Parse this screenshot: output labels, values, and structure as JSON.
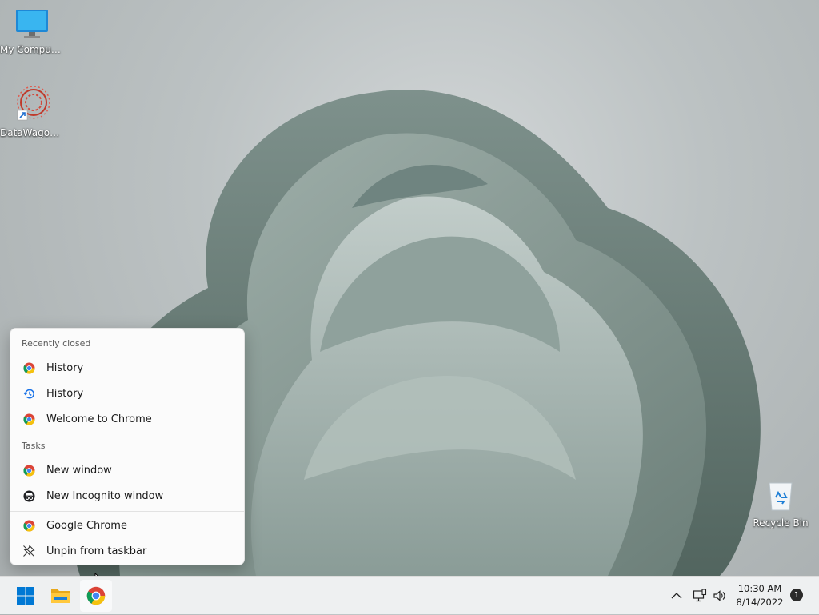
{
  "desktop": {
    "icons": [
      {
        "label": "My Computer",
        "icon": "monitor-icon"
      },
      {
        "label": "DataWagon...",
        "icon": "datawagon-app-icon"
      },
      {
        "label": "Recycle Bin",
        "icon": "recycle-bin-icon"
      }
    ]
  },
  "jumplist": {
    "recently_closed_title": "Recently closed",
    "recently_closed": [
      {
        "label": "History",
        "icon": "chrome-icon"
      },
      {
        "label": "History",
        "icon": "history-icon"
      },
      {
        "label": "Welcome to Chrome",
        "icon": "chrome-icon"
      }
    ],
    "tasks_title": "Tasks",
    "tasks": [
      {
        "label": "New window",
        "icon": "chrome-icon"
      },
      {
        "label": "New Incognito window",
        "icon": "incognito-icon"
      }
    ],
    "app": [
      {
        "label": "Google Chrome",
        "icon": "chrome-icon"
      },
      {
        "label": "Unpin from taskbar",
        "icon": "unpin-icon"
      }
    ]
  },
  "taskbar": {
    "buttons": [
      "start-button",
      "file-explorer-button",
      "chrome-button"
    ],
    "clock_time": "10:30 AM",
    "clock_date": "8/14/2022",
    "notification_count": "1"
  },
  "colors": {
    "taskbar": "#eef0f1",
    "jumplist": "#fbfbfb",
    "windows_blue": "#0078d4"
  }
}
